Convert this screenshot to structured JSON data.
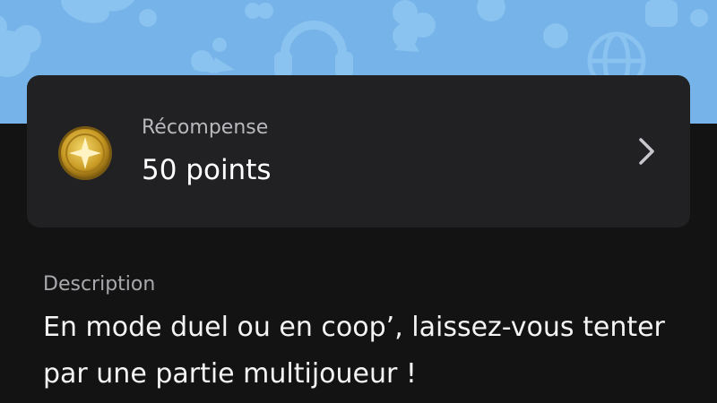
{
  "banner": {
    "background_color": "#75b3e8",
    "pattern_icons": [
      "bunny-ears-icon",
      "cloud-icon",
      "headphones-icon",
      "bow-icon",
      "heart-icon",
      "puzzle-icon",
      "globe-icon"
    ]
  },
  "reward": {
    "label": "Récompense",
    "value": "50 points",
    "coin_icon": "gold-star-coin-icon",
    "chevron_icon": "chevron-right-icon"
  },
  "description": {
    "label": "Description",
    "text": "En mode duel ou en coop’, laissez-vous tenter par une partie multijoueur !"
  },
  "colors": {
    "page_background": "#131314",
    "card_background": "#212123",
    "coin_gold": "#d8b43a"
  }
}
